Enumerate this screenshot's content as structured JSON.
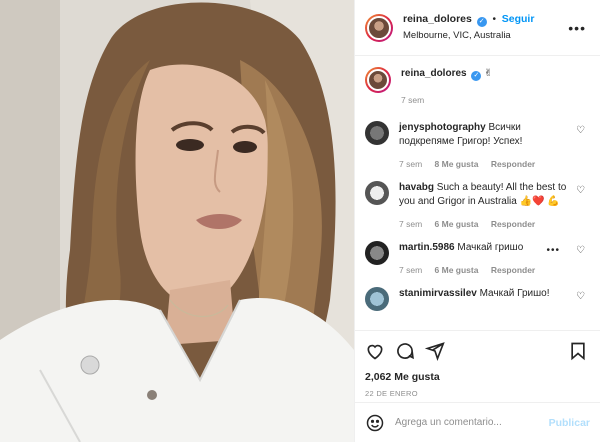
{
  "post": {
    "username": "reina_dolores",
    "follow_label": "Seguir",
    "location": "Melbourne, VIC, Australia",
    "caption_text": "✌",
    "caption_time": "7 sem",
    "likes": "2,062 Me gusta",
    "date": "22 DE ENERO"
  },
  "comments": [
    {
      "username": "jenysphotography",
      "text": "Всички подкрепяме Григор! Успех!",
      "time": "7 sem",
      "likes": "8 Me gusta",
      "reply": "Responder"
    },
    {
      "username": "havabg",
      "text": "Such a beauty! All the best to you and Grigor in Australia 👍❤️ 💪",
      "time": "7 sem",
      "likes": "6 Me gusta",
      "reply": "Responder"
    },
    {
      "username": "martin.5986",
      "text": "Мачкай гришо",
      "time": "7 sem",
      "likes": "6 Me gusta",
      "reply": "Responder"
    },
    {
      "username": "stanimirvassilev",
      "text": "Мачкай Гришо!",
      "time": "",
      "likes": "",
      "reply": ""
    }
  ],
  "composer": {
    "placeholder": "Agrega un comentario...",
    "publish_label": "Publicar"
  },
  "icons": [
    "verified-icon",
    "more-options-icon",
    "heart-icon",
    "comment-icon",
    "share-icon",
    "save-icon",
    "emoji-icon"
  ]
}
